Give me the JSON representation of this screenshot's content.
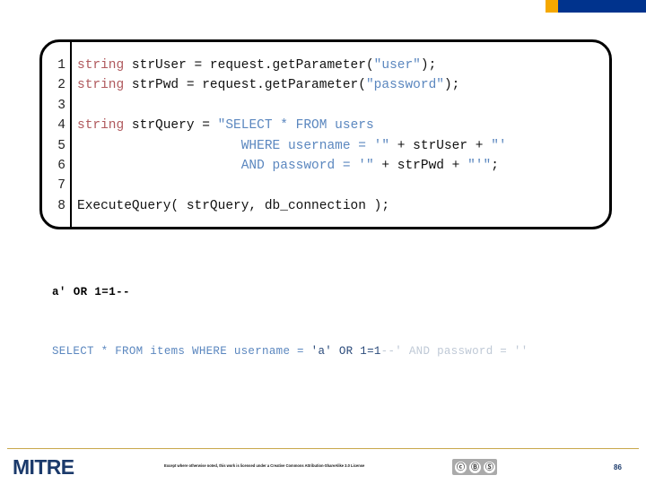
{
  "banner": {
    "accent_color": "#F5A800",
    "bar_color": "#00338D"
  },
  "code_block": {
    "language": "java",
    "keyword_color": "#B05A5E",
    "string_color": "#5B87BF",
    "plain_color": "#111111",
    "lines": [
      {
        "number": "1",
        "tokens": [
          {
            "text": "string ",
            "kind": "kw"
          },
          {
            "text": "strUser = request.getParameter(",
            "kind": "plain"
          },
          {
            "text": "\"user\"",
            "kind": "str"
          },
          {
            "text": ");",
            "kind": "plain"
          }
        ]
      },
      {
        "number": "2",
        "tokens": [
          {
            "text": "string ",
            "kind": "kw"
          },
          {
            "text": "strPwd = request.getParameter(",
            "kind": "plain"
          },
          {
            "text": "\"password\"",
            "kind": "str"
          },
          {
            "text": ");",
            "kind": "plain"
          }
        ]
      },
      {
        "number": "3",
        "tokens": []
      },
      {
        "number": "4",
        "tokens": [
          {
            "text": "string ",
            "kind": "kw"
          },
          {
            "text": "strQuery = ",
            "kind": "plain"
          },
          {
            "text": "\"SELECT * FROM users",
            "kind": "str"
          }
        ]
      },
      {
        "number": "5",
        "tokens": [
          {
            "text": "                     WHERE username = '\"",
            "kind": "str"
          },
          {
            "text": " + strUser + ",
            "kind": "plain"
          },
          {
            "text": "\"'",
            "kind": "str"
          }
        ]
      },
      {
        "number": "6",
        "tokens": [
          {
            "text": "                     AND password = '\"",
            "kind": "str"
          },
          {
            "text": " + strPwd + ",
            "kind": "plain"
          },
          {
            "text": "\"'\"",
            "kind": "str"
          },
          {
            "text": ";",
            "kind": "plain"
          }
        ]
      },
      {
        "number": "7",
        "tokens": []
      },
      {
        "number": "8",
        "tokens": [
          {
            "text": "ExecuteQuery( strQuery, db_connection );",
            "kind": "plain"
          }
        ]
      }
    ]
  },
  "payload": {
    "text": "a' OR 1=1--"
  },
  "resulting_query": {
    "segments": [
      {
        "text": "SELECT * FROM items WHERE username = ",
        "kind": "q-blue"
      },
      {
        "text": "'a' OR 1=1",
        "kind": "q-dark"
      },
      {
        "text": "--' AND password = ''",
        "kind": "q-faint"
      }
    ]
  },
  "footer": {
    "rule_color": "#C8A84B",
    "logo": "MITRE",
    "license": "Except where otherwise noted, this work is licensed under a Creative Commons Attribution-ShareAlike 3.0 License",
    "cc_badge": {
      "label": "cc-by-sa-badge",
      "glyphs": [
        "ⓒ",
        "Ⓑ",
        "Ⓢ"
      ]
    },
    "page_number": "86"
  }
}
